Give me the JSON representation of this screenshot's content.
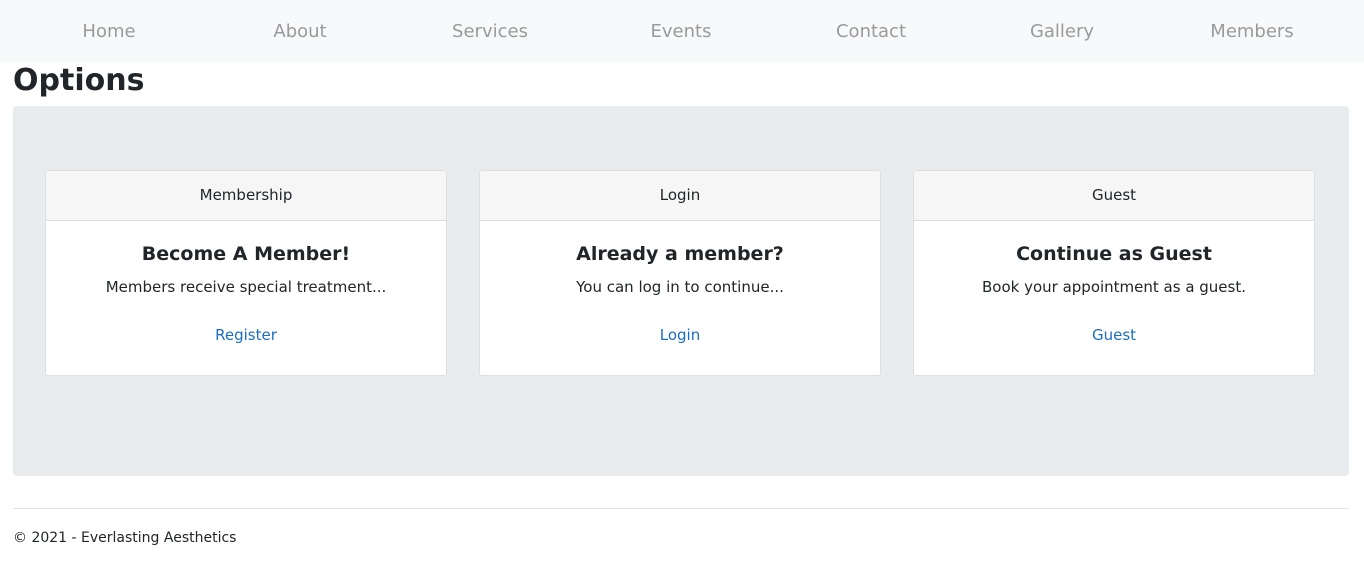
{
  "nav": {
    "items": [
      {
        "label": "Home"
      },
      {
        "label": "About"
      },
      {
        "label": "Services"
      },
      {
        "label": "Events"
      },
      {
        "label": "Contact"
      },
      {
        "label": "Gallery"
      },
      {
        "label": "Members"
      }
    ]
  },
  "page": {
    "title": "Options"
  },
  "cards": [
    {
      "header": "Membership",
      "title": "Become A Member!",
      "text": "Members receive special treatment...",
      "link_label": "Register"
    },
    {
      "header": "Login",
      "title": "Already a member?",
      "text": "You can log in to continue...",
      "link_label": "Login"
    },
    {
      "header": "Guest",
      "title": "Continue as Guest",
      "text": "Book your appointment as a guest.",
      "link_label": "Guest"
    }
  ],
  "footer": {
    "text": "© 2021 - Everlasting Aesthetics"
  },
  "colors": {
    "nav_background": "#f8f9fa",
    "nav_link": "#9a9a9a",
    "panel_background": "#e9ecef",
    "link": "#1b6ec2"
  }
}
